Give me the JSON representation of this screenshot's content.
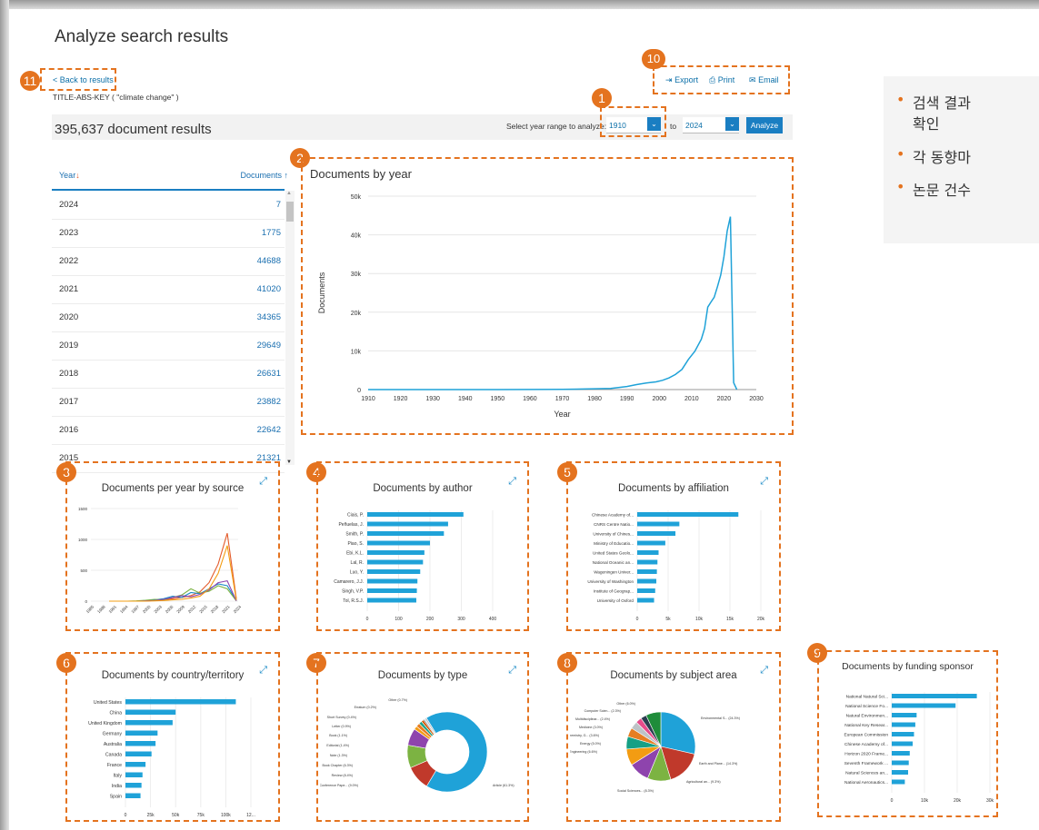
{
  "page_title": "Analyze search results",
  "back_link": "< Back to results",
  "query": "TITLE-ABS-KEY ( \"climate change\" )",
  "results_count": "395,637 document results",
  "year_range": {
    "label": "Select year range to analyze:",
    "from": "1910",
    "to_label": "to",
    "to": "2024",
    "analyze": "Analyze"
  },
  "actions": {
    "export": "Export",
    "print": "Print",
    "email": "Email"
  },
  "badges": [
    "1",
    "2",
    "3",
    "4",
    "5",
    "6",
    "7",
    "8",
    "9",
    "10",
    "11"
  ],
  "table": {
    "col_year": "Year",
    "col_docs": "Documents",
    "rows": [
      {
        "year": "2024",
        "docs": "7"
      },
      {
        "year": "2023",
        "docs": "1775"
      },
      {
        "year": "2022",
        "docs": "44688"
      },
      {
        "year": "2021",
        "docs": "41020"
      },
      {
        "year": "2020",
        "docs": "34365"
      },
      {
        "year": "2019",
        "docs": "29649"
      },
      {
        "year": "2018",
        "docs": "26631"
      },
      {
        "year": "2017",
        "docs": "23882"
      },
      {
        "year": "2016",
        "docs": "22642"
      },
      {
        "year": "2015",
        "docs": "21321"
      }
    ]
  },
  "panels": {
    "per_source": "Documents per year by source",
    "by_author": "Documents by author",
    "by_affiliation": "Documents by affiliation",
    "by_country": "Documents by country/territory",
    "by_type": "Documents by type",
    "by_subject": "Documents by subject area",
    "by_funding": "Documents by funding sponsor"
  },
  "bullets": [
    "검색 결과",
    "확인",
    "각 동향마",
    "논문 건수"
  ],
  "chart_data": [
    {
      "type": "line",
      "title": "Documents by year",
      "xlabel": "Year",
      "ylabel": "Documents",
      "xlim": [
        1910,
        2030
      ],
      "ylim": [
        0,
        50000
      ],
      "x_ticks": [
        "1910",
        "1920",
        "1930",
        "1940",
        "1950",
        "1960",
        "1970",
        "1980",
        "1990",
        "2000",
        "2010",
        "2020",
        "2030"
      ],
      "y_ticks": [
        "0",
        "10k",
        "20k",
        "30k",
        "40k",
        "50k"
      ],
      "x": [
        1910,
        1950,
        1970,
        1980,
        1985,
        1990,
        1993,
        1996,
        1999,
        2001,
        2003,
        2005,
        2007,
        2009,
        2011,
        2013,
        2014,
        2015,
        2016,
        2017,
        2018,
        2019,
        2020,
        2021,
        2022,
        2023,
        2024
      ],
      "y": [
        0,
        0,
        50,
        200,
        300,
        800,
        1300,
        1700,
        2000,
        2400,
        3000,
        3900,
        5200,
        7800,
        9900,
        13000,
        15800,
        21321,
        22642,
        23882,
        26631,
        29649,
        34365,
        41020,
        44688,
        1775,
        7
      ]
    },
    {
      "type": "bar",
      "title": "Documents by author",
      "categories": [
        "Ciais, P.",
        "Peñuelas, J.",
        "Smith, P.",
        "Piao, S.",
        "Ebi, K.L.",
        "Lal, R.",
        "Luo, Y.",
        "Camarero, J.J.",
        "Singh, V.P.",
        "Tol, R.S.J."
      ],
      "values": [
        345,
        290,
        275,
        225,
        205,
        200,
        190,
        180,
        178,
        176
      ],
      "x_ticks": [
        "0",
        "100",
        "200",
        "300",
        "400"
      ],
      "xlim": [
        0,
        450
      ]
    },
    {
      "type": "bar",
      "title": "Documents by affiliation",
      "categories": [
        "Chinese Academy of...",
        "CNRS Centre Natio...",
        "University of Chines...",
        "Ministry of Educatio...",
        "United States Geolo...",
        "National Oceanic an...",
        "Wageningen Univer...",
        "University of Washington",
        "Institute of Geograp...",
        "University of Oxford"
      ],
      "values": [
        18000,
        7500,
        6800,
        5000,
        3800,
        3600,
        3500,
        3400,
        3200,
        3000
      ],
      "x_ticks": [
        "0",
        "5k",
        "10k",
        "15k",
        "20k"
      ],
      "xlim": [
        0,
        22000
      ]
    },
    {
      "type": "bar",
      "title": "Documents by country/territory",
      "categories": [
        "United States",
        "China",
        "United Kingdom",
        "Germany",
        "Australia",
        "Canada",
        "France",
        "Italy",
        "India",
        "Spain"
      ],
      "values": [
        110000,
        50000,
        47000,
        32000,
        30000,
        26000,
        20000,
        17000,
        16000,
        15000
      ],
      "x_ticks": [
        "0",
        "25k",
        "50k",
        "75k",
        "100k",
        "12..."
      ],
      "xlim": [
        0,
        125000
      ]
    },
    {
      "type": "pie",
      "title": "Documents by type",
      "categories": [
        "Article (61.3%)",
        "Conference Pape... (9.0%)",
        "Review (8.4%)",
        "Book Chapter (6.3%)",
        "Note (1.3%)",
        "Editorial (1.4%)",
        "Book (1.1%)",
        "Letter (0.9%)",
        "Short Survey (0.4%)",
        "Erratum (0.2%)",
        "Other (0.7%)"
      ],
      "values": [
        61.3,
        9.0,
        8.4,
        6.3,
        1.3,
        1.4,
        1.1,
        0.9,
        0.4,
        0.2,
        0.7
      ]
    },
    {
      "type": "pie",
      "title": "Documents by subject area",
      "categories": [
        "Environmental S... (24.3%)",
        "Earth and Plane... (14.3%)",
        "Agricultural an... (9.3%)",
        "Social Sciences... (8.3%)",
        "Engineering (6.6%)",
        "Energy (5.0%)",
        "Biochemistry, G... (3.6%)",
        "Medicine (3.0%)",
        "Multidisciplinar... (2.4%)",
        "Computer Scien... (2.3%)",
        "Other (6.0%)"
      ],
      "values": [
        24.3,
        14.3,
        9.3,
        8.3,
        6.6,
        5.0,
        3.6,
        3.0,
        2.4,
        2.3,
        6.0
      ]
    },
    {
      "type": "bar",
      "title": "Documents by funding sponsor",
      "categories": [
        "National Natural Sci...",
        "National Science Fo...",
        "Natural Environmen...",
        "National Key Resear...",
        "European Commission",
        "Chinese Academy of...",
        "Horizon 2020 Frame...",
        "Seventh Framework ...",
        "Natural Sciences an...",
        "National Aeronautics..."
      ],
      "values": [
        26000,
        19500,
        7600,
        7200,
        6800,
        6400,
        5500,
        5200,
        5000,
        4000
      ],
      "x_ticks": [
        "0",
        "10k",
        "20k",
        "30k"
      ],
      "xlim": [
        0,
        30000
      ]
    },
    {
      "type": "line",
      "title": "Documents per year by source",
      "y_ticks": [
        "0",
        "500",
        "1000",
        "1500"
      ],
      "ylim": [
        0,
        1500
      ],
      "x_ticks": [
        "1985",
        "1988",
        "1991",
        "1994",
        "1997",
        "2000",
        "2003",
        "2006",
        "2009",
        "2012",
        "2015",
        "2018",
        "2021",
        "2024"
      ],
      "series": [
        {
          "color": "#e35b2b",
          "values": [
            0,
            0,
            0,
            0,
            5,
            10,
            20,
            40,
            60,
            90,
            150,
            300,
            600,
            1100,
            40
          ]
        },
        {
          "color": "#1a8ac6",
          "values": [
            0,
            0,
            0,
            0,
            10,
            20,
            40,
            80,
            60,
            140,
            120,
            200,
            280,
            250,
            10
          ]
        },
        {
          "color": "#7cb342",
          "values": [
            0,
            0,
            0,
            5,
            15,
            30,
            20,
            60,
            100,
            200,
            130,
            160,
            250,
            200,
            5
          ]
        },
        {
          "color": "#8e44ad",
          "values": [
            0,
            0,
            0,
            0,
            5,
            10,
            30,
            60,
            90,
            70,
            110,
            180,
            300,
            330,
            5
          ]
        },
        {
          "color": "#f39c12",
          "values": [
            0,
            0,
            0,
            0,
            0,
            5,
            10,
            20,
            30,
            50,
            80,
            200,
            450,
            900,
            20
          ]
        }
      ]
    }
  ]
}
